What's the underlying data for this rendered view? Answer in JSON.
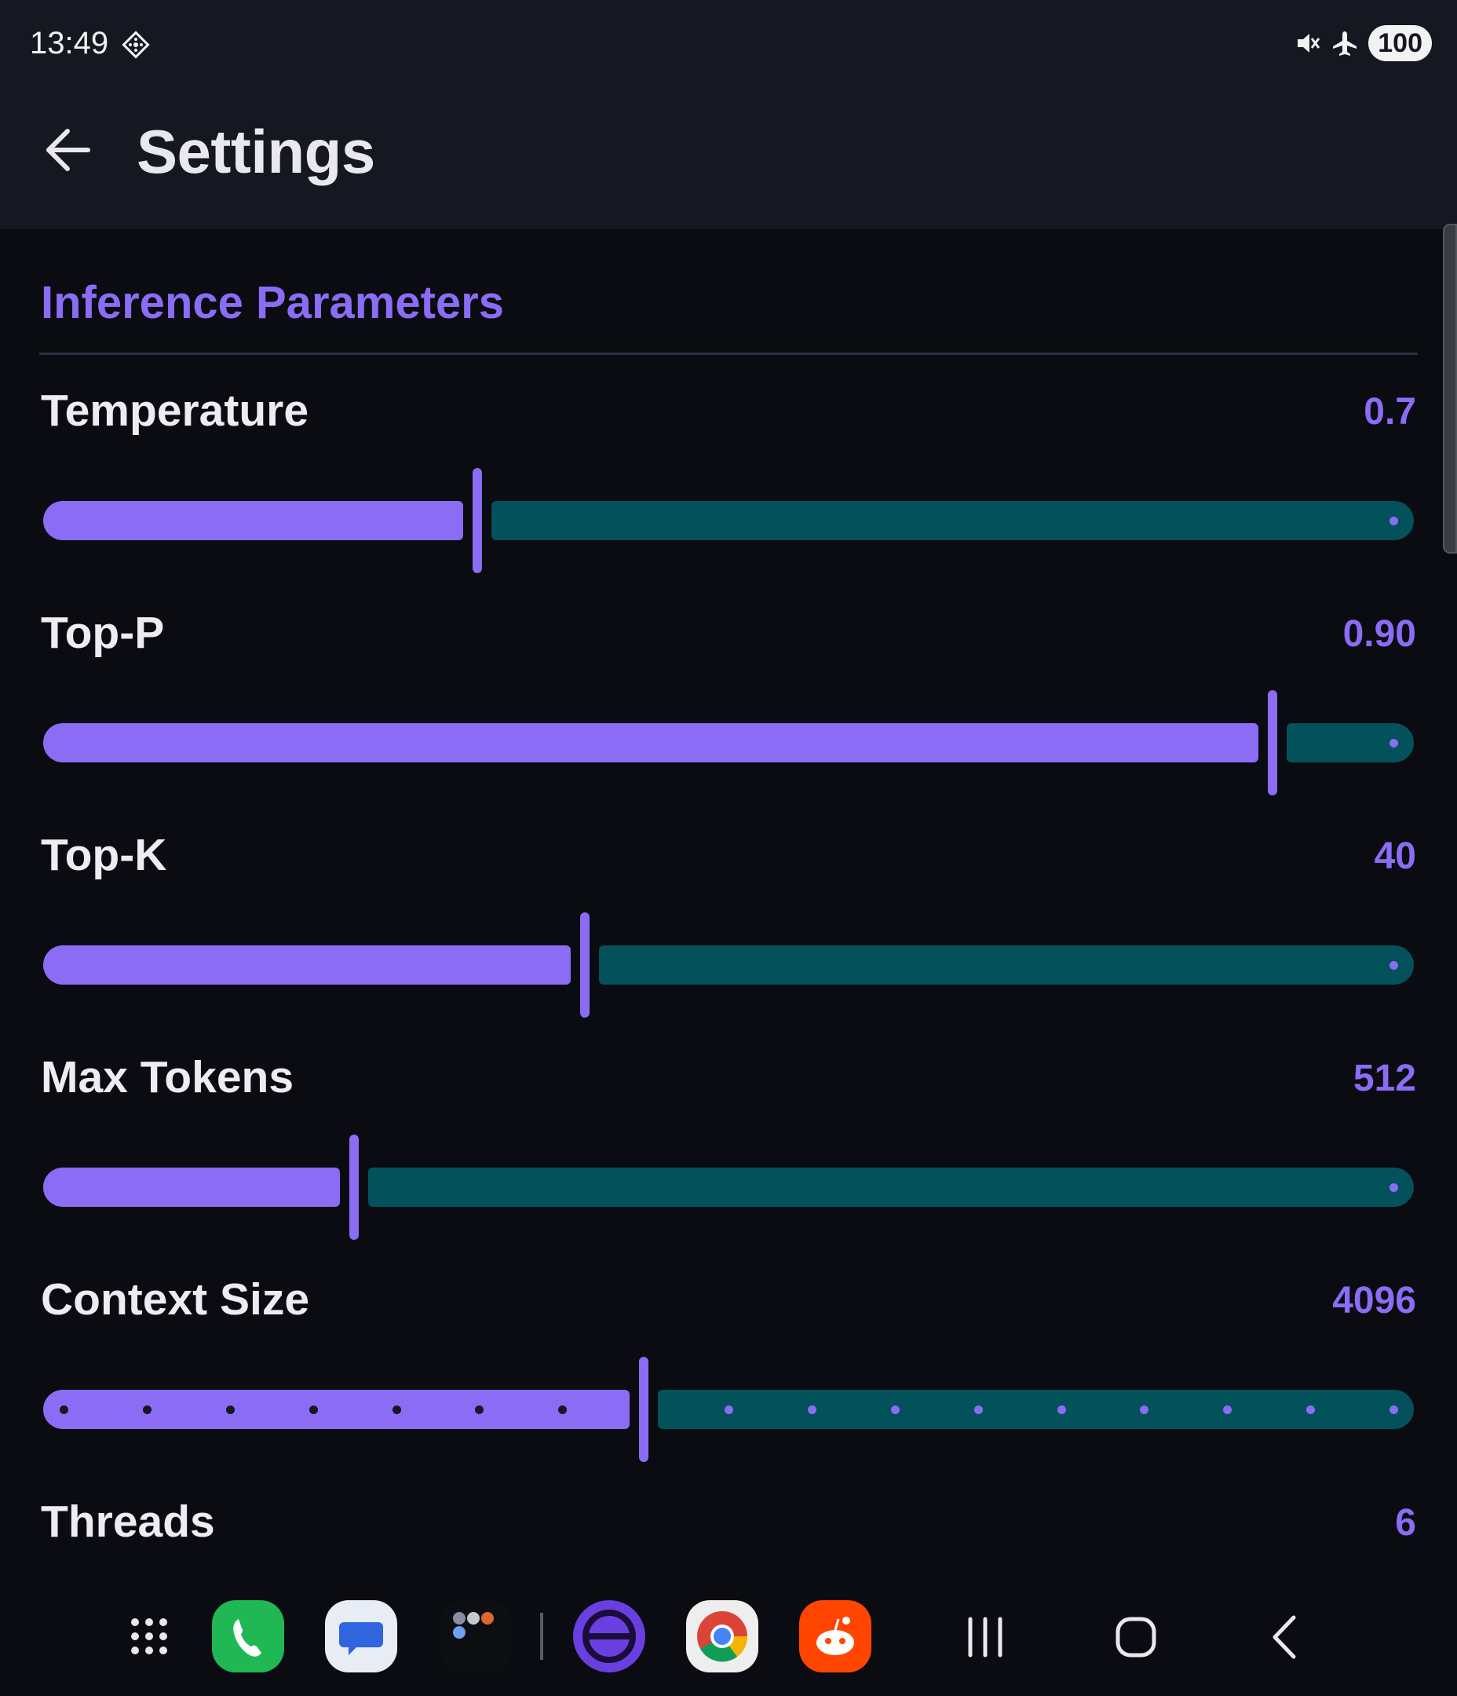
{
  "status_bar": {
    "time": "13:49",
    "battery": "100",
    "icons": [
      "tile-icon",
      "mute-icon",
      "airplane-icon"
    ]
  },
  "header": {
    "title": "Settings",
    "back_icon": "arrow-left-icon"
  },
  "section": {
    "title": "Inference Parameters"
  },
  "parameters": [
    {
      "label": "Temperature",
      "value": "0.7",
      "fraction": 0.317,
      "steps": 0
    },
    {
      "label": "Top-P",
      "value": "0.90",
      "fraction": 0.897,
      "steps": 0
    },
    {
      "label": "Top-K",
      "value": "40",
      "fraction": 0.395,
      "steps": 0
    },
    {
      "label": "Max Tokens",
      "value": "512",
      "fraction": 0.227,
      "steps": 0
    },
    {
      "label": "Context Size",
      "value": "4096",
      "fraction": 0.438,
      "steps": 16
    },
    {
      "label": "Threads",
      "value": "6"
    }
  ],
  "dock": {
    "apps": [
      "app-drawer-icon",
      "phone-icon",
      "messages-icon",
      "folder-icon",
      "browser-icon",
      "chrome-icon",
      "reddit-icon"
    ],
    "nav": [
      "recents-icon",
      "home-icon",
      "back-icon"
    ]
  },
  "colors": {
    "accent": "#8b6cf5",
    "track_inactive": "#03515a",
    "background": "#0b0c11",
    "app_bar": "#151821"
  }
}
